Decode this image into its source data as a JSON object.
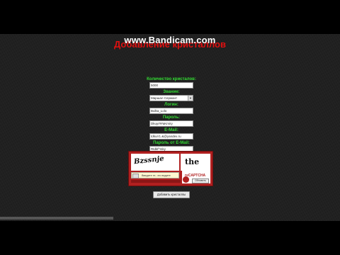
{
  "watermark": "www.Bandicam.com",
  "title": "Добавление кристаллов",
  "form": {
    "crystals_label": "Количество кристалов:",
    "crystals_value": "5000",
    "rank_label": "Звание:",
    "rank_value": "Маршал Сержант",
    "login_label": "Логин:",
    "login_value": "Bulka_Lolo",
    "password_label": "Пароль:",
    "password_value": "Dkuyr##aKmiry",
    "email_label": "E-Mail:",
    "email_value": "tdkurr1.&@yandex.ru",
    "email_password_label": "Пароль от E-Mail:",
    "email_password_value": "Rtdkf^mky"
  },
  "captcha": {
    "word1": "Bzssnje",
    "word2": "the",
    "input_placeholder": "Введите те, что видите",
    "refresh_label": "Обновить",
    "logo_text": "reCAPTCHA"
  },
  "submit_label": "Добавить кристаллы",
  "colors": {
    "title": "#e01010",
    "labels": "#33dd33",
    "captcha_frame": "#b02020"
  }
}
